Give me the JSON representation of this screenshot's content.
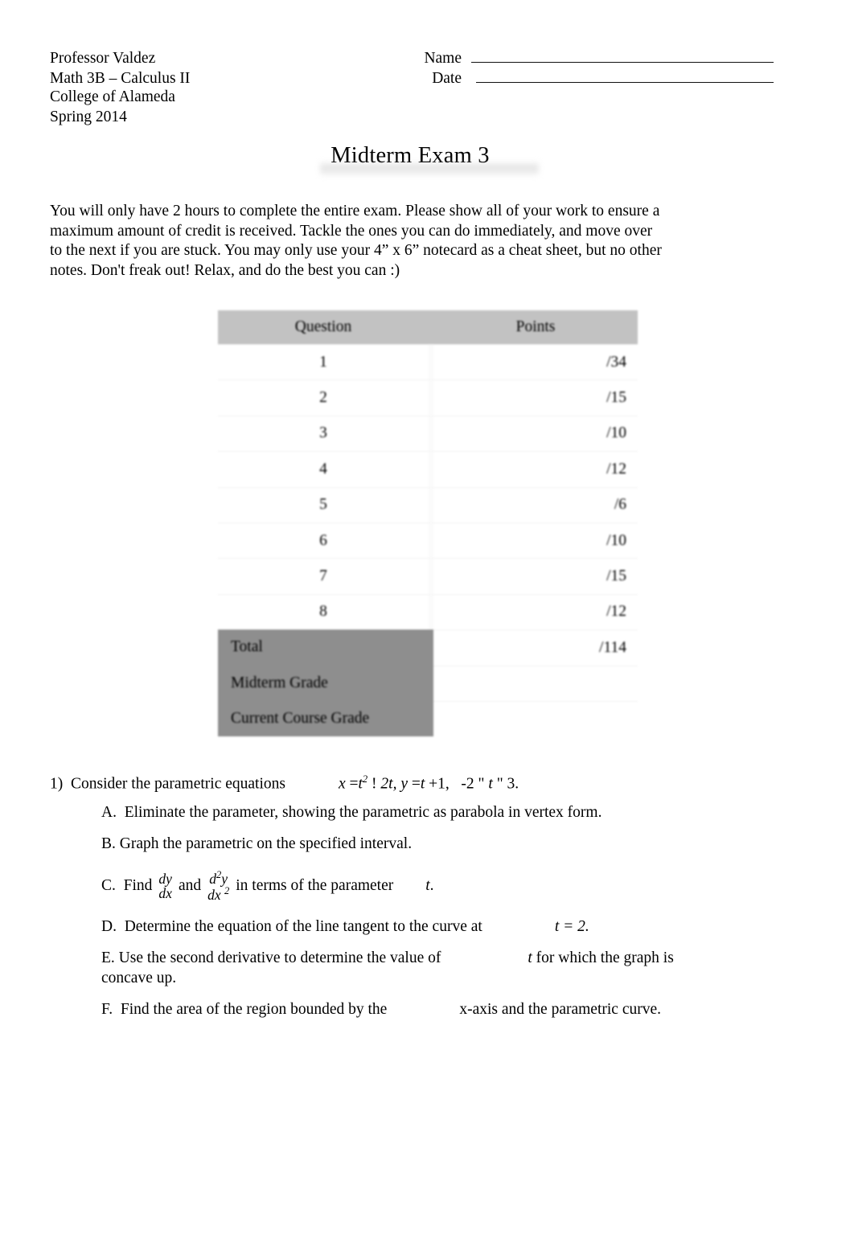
{
  "header": {
    "instructor": "Professor Valdez",
    "course": "Math 3B – Calculus II",
    "school": "College of Alameda",
    "term": "Spring 2014",
    "name_label": "Name",
    "date_label": "Date"
  },
  "title": "Midterm Exam 3",
  "instructions": "You will only have 2 hours to complete the entire exam. Please show all of your work to ensure a maximum amount of credit is received. Tackle the ones you can do immediately, and move over to the next if you are stuck. You may only use your 4” x 6” notecard as a cheat sheet, but no other notes. Don't freak out! Relax, and do the best you can :)",
  "score_table": {
    "headers": [
      "Question",
      "Points"
    ],
    "rows": [
      {
        "question": "1",
        "points": "/34"
      },
      {
        "question": "2",
        "points": "/15"
      },
      {
        "question": "3",
        "points": "/10"
      },
      {
        "question": "4",
        "points": "/12"
      },
      {
        "question": "5",
        "points": "/6"
      },
      {
        "question": "6",
        "points": "/10"
      },
      {
        "question": "7",
        "points": "/15"
      },
      {
        "question": "8",
        "points": "/12"
      }
    ],
    "summary_rows": [
      {
        "label": "Total",
        "points": "/114"
      },
      {
        "label": "Midterm Grade",
        "points": ""
      },
      {
        "label": "Current Course Grade",
        "points": ""
      }
    ],
    "header_bg": "#c2c2c2",
    "summary_bg": "#8e8e8e"
  },
  "question1": {
    "number": "1)",
    "stem": "Consider the parametric equations",
    "equation": "x = t ² ! 2t, y = t +1,   -2 \" t \" 3.",
    "eq_parts": {
      "x_var": "x",
      "eq1": "=",
      "t_var": "t",
      "exp2": "2",
      "bang": "!",
      "two_t": "2t,",
      "y_var": "y",
      "eq2": "=",
      "t_var2": "t",
      "plus1": "+1,",
      "minus2": "-2",
      "quote1": "\"",
      "t_var3": "t",
      "quote2": "\"",
      "three": "3."
    },
    "parts": {
      "A": {
        "letter": "A.",
        "text": "Eliminate the parameter, showing the parametric as parabola in vertex form."
      },
      "B": {
        "letter": "B.",
        "text": "Graph the parametric on the specified interval."
      },
      "C": {
        "letter": "C.",
        "find": "Find",
        "frac1_num": "dy",
        "frac1_den": "dx",
        "and": "and",
        "frac2_num": "d",
        "frac2_num_sup": "2",
        "frac2_num_y": "y",
        "frac2_den": "dx",
        "frac2_den_sup": "2",
        "tail": "in terms of the parameter",
        "variable": "t",
        "period": "."
      },
      "D": {
        "letter": "D.",
        "text": "Determine the equation of the line tangent to the curve at",
        "value": "t =  2."
      },
      "E": {
        "letter": "E.",
        "text": "Use the second derivative to determine the value of",
        "variable": "t",
        "text2": "for which the graph is",
        "text3": "concave up."
      },
      "F": {
        "letter": "F.",
        "text": "Find the area of the region bounded by the",
        "text2": "x-axis and the parametric curve."
      }
    }
  }
}
